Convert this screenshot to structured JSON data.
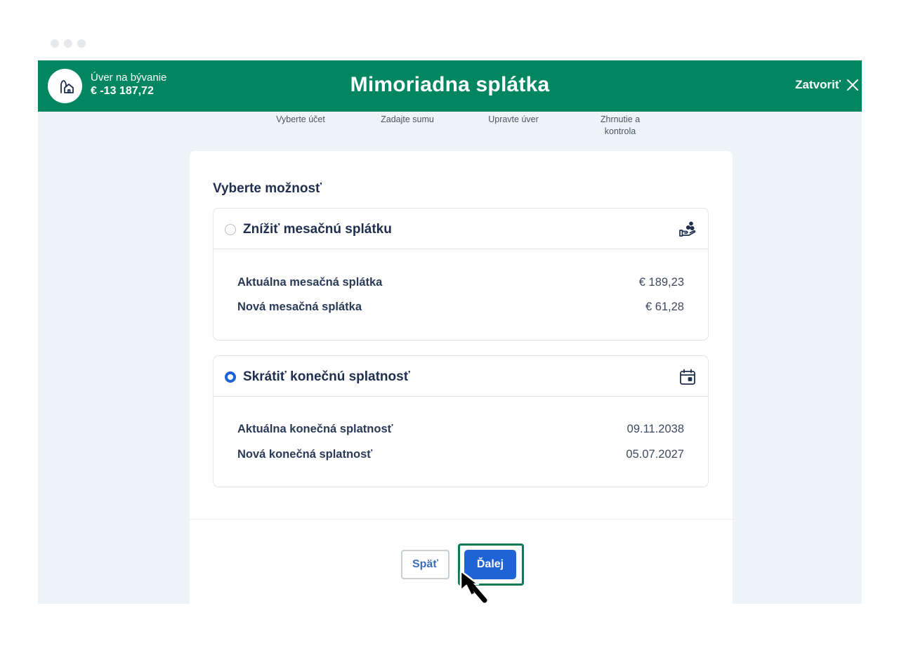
{
  "header": {
    "account_name": "Úver na bývanie",
    "account_balance": "€ -13 187,72",
    "title": "Mimoriadna splátka",
    "close_label": "Zatvoriť",
    "brand_color": "#028660"
  },
  "steps": [
    {
      "label": "Vyberte účet"
    },
    {
      "label": "Zadajte sumu"
    },
    {
      "label": "Upravte úver"
    },
    {
      "label": "Zhrnutie a kontrola"
    }
  ],
  "card": {
    "title": "Vyberte možnosť",
    "options": [
      {
        "label": "Znížiť mesačnú splátku",
        "selected": false,
        "icon": "hand-coins-icon",
        "rows": [
          {
            "label": "Aktuálna mesačná splátka",
            "value": "€ 189,23"
          },
          {
            "label": "Nová mesačná splátka",
            "value": "€ 61,28"
          }
        ]
      },
      {
        "label": "Skrátiť konečnú splatnosť",
        "selected": true,
        "icon": "calendar-icon",
        "rows": [
          {
            "label": "Aktuálna konečná splatnosť",
            "value": "09.11.2038"
          },
          {
            "label": "Nová konečná splatnosť",
            "value": "05.07.2027"
          }
        ]
      }
    ]
  },
  "buttons": {
    "back_label": "Späť",
    "next_label": "Ďalej",
    "primary_color": "#1f63d6"
  }
}
